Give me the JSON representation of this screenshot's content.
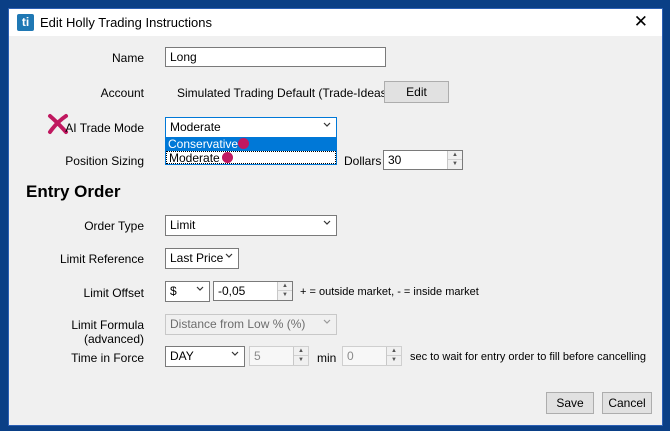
{
  "window": {
    "title": "Edit Holly Trading Instructions",
    "app_icon_text": "ti"
  },
  "form": {
    "name_label": "Name",
    "name_value": "Long",
    "account_label": "Account",
    "account_value": "Simulated Trading Default (Trade-Ideas)",
    "account_edit_label": "Edit",
    "ai_mode_label": "AI Trade Mode",
    "ai_mode_value": "Moderate",
    "ai_mode_options": [
      "Conservative",
      "Moderate"
    ],
    "position_sizing_label": "Position Sizing",
    "dollars_label": "Dollars",
    "dollars_value": "30"
  },
  "entry": {
    "heading": "Entry Order",
    "order_type_label": "Order Type",
    "order_type_value": "Limit",
    "limit_reference_label": "Limit Reference",
    "limit_reference_value": "Last Price",
    "limit_offset_label": "Limit Offset",
    "limit_offset_unit": "$",
    "limit_offset_value": "-0,05",
    "limit_offset_hint": "+ = outside market, - = inside market",
    "limit_formula_label": "Limit Formula (advanced)",
    "limit_formula_value": "Distance from Low % (%)",
    "tif_label": "Time in Force",
    "tif_value": "DAY",
    "tif_minutes": "5",
    "min_label": "min",
    "tif_seconds": "0",
    "seconds_hint": "sec to wait for entry order to fill before cancelling"
  },
  "buttons": {
    "save": "Save",
    "cancel": "Cancel"
  },
  "colors": {
    "accent": "#0078d7",
    "marker": "#c0185f",
    "desktop": "#0a3f86"
  }
}
